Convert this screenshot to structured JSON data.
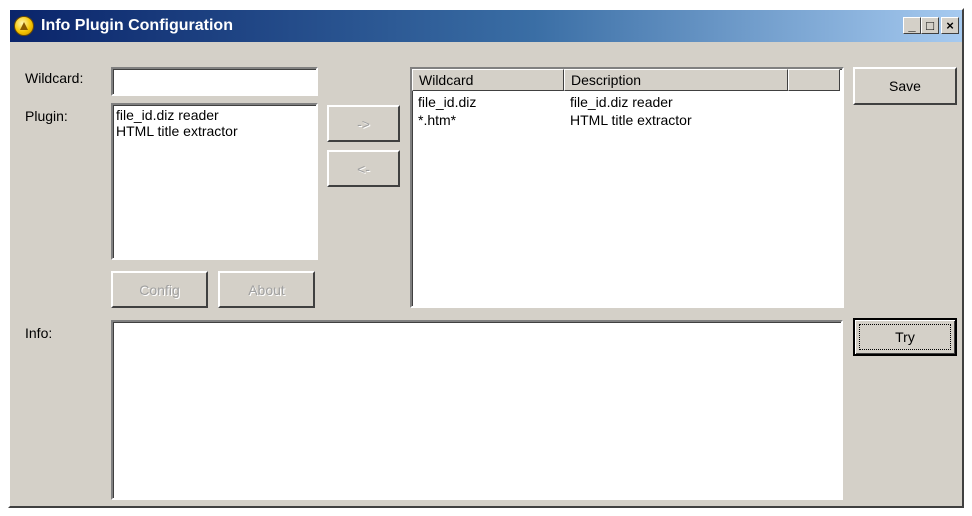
{
  "window": {
    "title": "Info Plugin Configuration",
    "minimize_glyph": "_",
    "maximize_glyph": "□",
    "close_glyph": "×"
  },
  "wildcard": {
    "label": "Wildcard:",
    "value": ""
  },
  "plugin": {
    "label": "Plugin:",
    "items": [
      "file_id.diz reader",
      "HTML title extractor"
    ]
  },
  "buttons": {
    "add": "->",
    "remove": "<-",
    "config": "Config",
    "about": "About",
    "save": "Save",
    "try": "Try"
  },
  "mappings": {
    "columns": [
      "Wildcard",
      "Description",
      ""
    ],
    "rows": [
      {
        "wildcard": "file_id.diz",
        "description": "file_id.diz reader"
      },
      {
        "wildcard": "*.htm*",
        "description": "HTML title extractor"
      }
    ]
  },
  "info": {
    "label": "Info:",
    "value": ""
  },
  "colors": {
    "titlebar_start": "#0a246a",
    "titlebar_end": "#a6caf0",
    "face": "#d4d0c8"
  },
  "icons": {
    "app": "plugin-app-icon"
  }
}
